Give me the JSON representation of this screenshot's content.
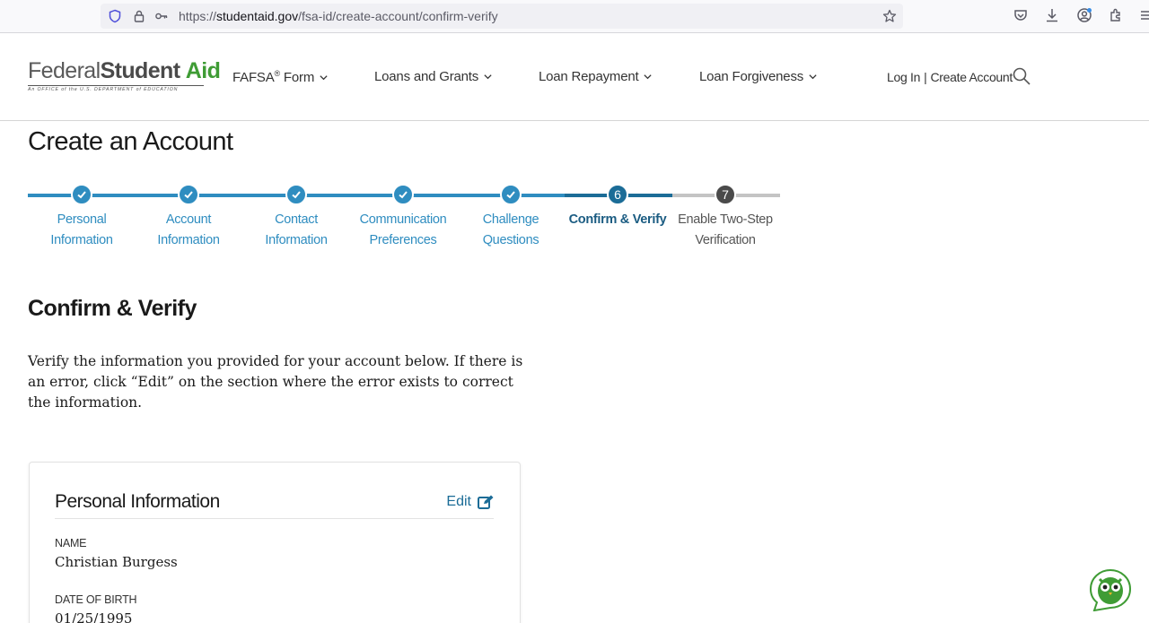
{
  "browser": {
    "url_prefix": "https://",
    "url_host": "studentaid.gov",
    "url_path": "/fsa-id/create-account/confirm-verify"
  },
  "header": {
    "logo_federal": "Federal",
    "logo_student": "Student",
    "logo_aid": "Aid",
    "logo_tagline": "An OFFICE of the U.S. DEPARTMENT of EDUCATION",
    "nav": {
      "fafsa": "FAFSA",
      "fafsa_sup": "®",
      "fafsa_suffix": "Form",
      "loans": "Loans and Grants",
      "repayment": "Loan Repayment",
      "forgiveness": "Loan Forgiveness"
    },
    "login": "Log In",
    "separator": "|",
    "create_account": "Create Account"
  },
  "page": {
    "title": "Create an Account",
    "section_title": "Confirm & Verify",
    "intro": "Verify the information you provided for your account below. If there is an error, click “Edit” on the section where the error exists to correct the information."
  },
  "stepper": {
    "steps": [
      {
        "label_1": "Personal",
        "label_2": "Information",
        "state": "done"
      },
      {
        "label_1": "Account",
        "label_2": "Information",
        "state": "done"
      },
      {
        "label_1": "Contact Information",
        "label_2": "",
        "state": "done"
      },
      {
        "label_1": "Communication",
        "label_2": "Preferences",
        "state": "done"
      },
      {
        "label_1": "Challenge",
        "label_2": "Questions",
        "state": "done"
      },
      {
        "label_1": "Confirm & Verify",
        "label_2": "",
        "state": "current",
        "number": "6"
      },
      {
        "label_1": "Enable Two-Step",
        "label_2": "Verification",
        "state": "todo",
        "number": "7"
      }
    ],
    "colors": {
      "done": "#2f8dc0",
      "current": "#1b6c97",
      "todo": "#4a4a4a",
      "track_todo": "#c4c4c4"
    }
  },
  "card": {
    "title": "Personal Information",
    "edit_label": "Edit",
    "fields": {
      "name_label": "NAME",
      "name_value": "Christian Burgess",
      "dob_label": "DATE OF BIRTH",
      "dob_value": "01/25/1995"
    }
  },
  "icons": {
    "shield": "shield-icon",
    "lock": "lock-icon",
    "key": "key-icon",
    "star": "bookmark-star-icon",
    "pocket": "pocket-icon",
    "download": "download-icon",
    "account": "account-icon",
    "extensions": "extensions-icon",
    "menu": "menu-icon",
    "search": "search-icon",
    "edit": "edit-icon",
    "chat": "owl-chat-icon"
  }
}
